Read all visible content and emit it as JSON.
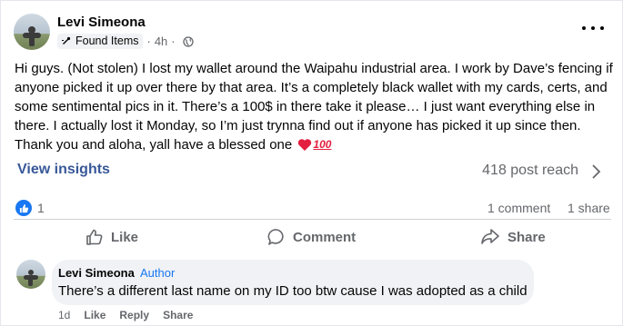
{
  "post": {
    "author": "Levi Simeona",
    "group_badge": "Found Items",
    "time": "4h",
    "separator": "·",
    "text": "Hi guys. (Not stolen) I lost my wallet around the Waipahu industrial area. I work by Dave’s fencing if anyone picked it up over there by that area. It’s a completely black wallet with my cards, certs, and some sentimental pics in it. There’s a 100$ in there take it please… I just want everything else in there. I actually lost it Monday, so I’m just trynna find out if anyone has picked it up since then. Thank you and aloha, yall have a blessed one",
    "emoji_hundred": "100"
  },
  "insights": {
    "label": "View insights",
    "reach": "418 post reach"
  },
  "stats": {
    "likes": "1",
    "comments": "1 comment",
    "shares": "1 share"
  },
  "actions": {
    "like": "Like",
    "comment": "Comment",
    "share": "Share"
  },
  "comment": {
    "author": "Levi Simeona",
    "role": "Author",
    "text": "There’s a different last name on my ID too btw cause I was adopted as a child",
    "time": "1d",
    "like": "Like",
    "reply": "Reply",
    "share": "Share"
  },
  "colors": {
    "accent": "#1877f2",
    "link": "#385898",
    "muted": "#65676b",
    "heart": "#e41e3f"
  },
  "icons": [
    "more-icon",
    "globe-icon",
    "group-icon",
    "chevron-right-icon",
    "thumbs-up-icon",
    "comment-icon",
    "share-icon",
    "heart-emoji-icon",
    "hundred-emoji-icon"
  ]
}
